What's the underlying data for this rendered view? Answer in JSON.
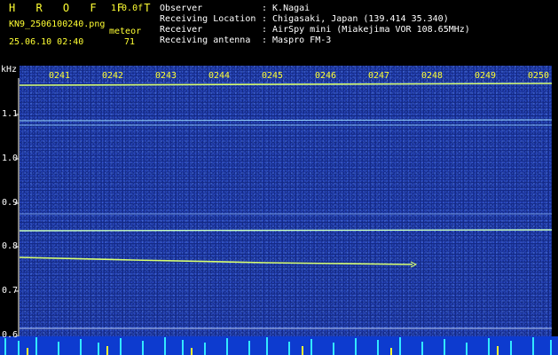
{
  "header": {
    "app_title": "H R O F F T",
    "version": "1.0.0f",
    "filename": "KN9_2506100240.png",
    "datetime": "25.06.10 02:40",
    "meteor_label": "meteor",
    "meteor_count": "71",
    "info": [
      {
        "label": "Observer",
        "value": ": K.Nagai"
      },
      {
        "label": "Receiving Location",
        "value": ": Chigasaki, Japan (139.414 35.340)"
      },
      {
        "label": "Receiver",
        "value": ": AirSpy mini (Miakejima VOR 108.65MHz)"
      },
      {
        "label": "Receiving antenna",
        "value": ": Maspro FM-3"
      }
    ]
  },
  "spectrogram": {
    "y_unit": "kHz",
    "y_ticks": [
      "1.1",
      "1.0",
      "0.9",
      "0.8",
      "0.7",
      "0.6"
    ],
    "time_labels": [
      "0241",
      "0242",
      "0243",
      "0244",
      "0245",
      "0246",
      "0247",
      "0248",
      "0249",
      "0250"
    ]
  },
  "colors": {
    "text_yellow": "#ffff33",
    "text_white": "#ffffff",
    "background_blue": "#142a86",
    "trace_cyan": "#9ad8ff",
    "trace_yellow": "#d8ff70"
  }
}
